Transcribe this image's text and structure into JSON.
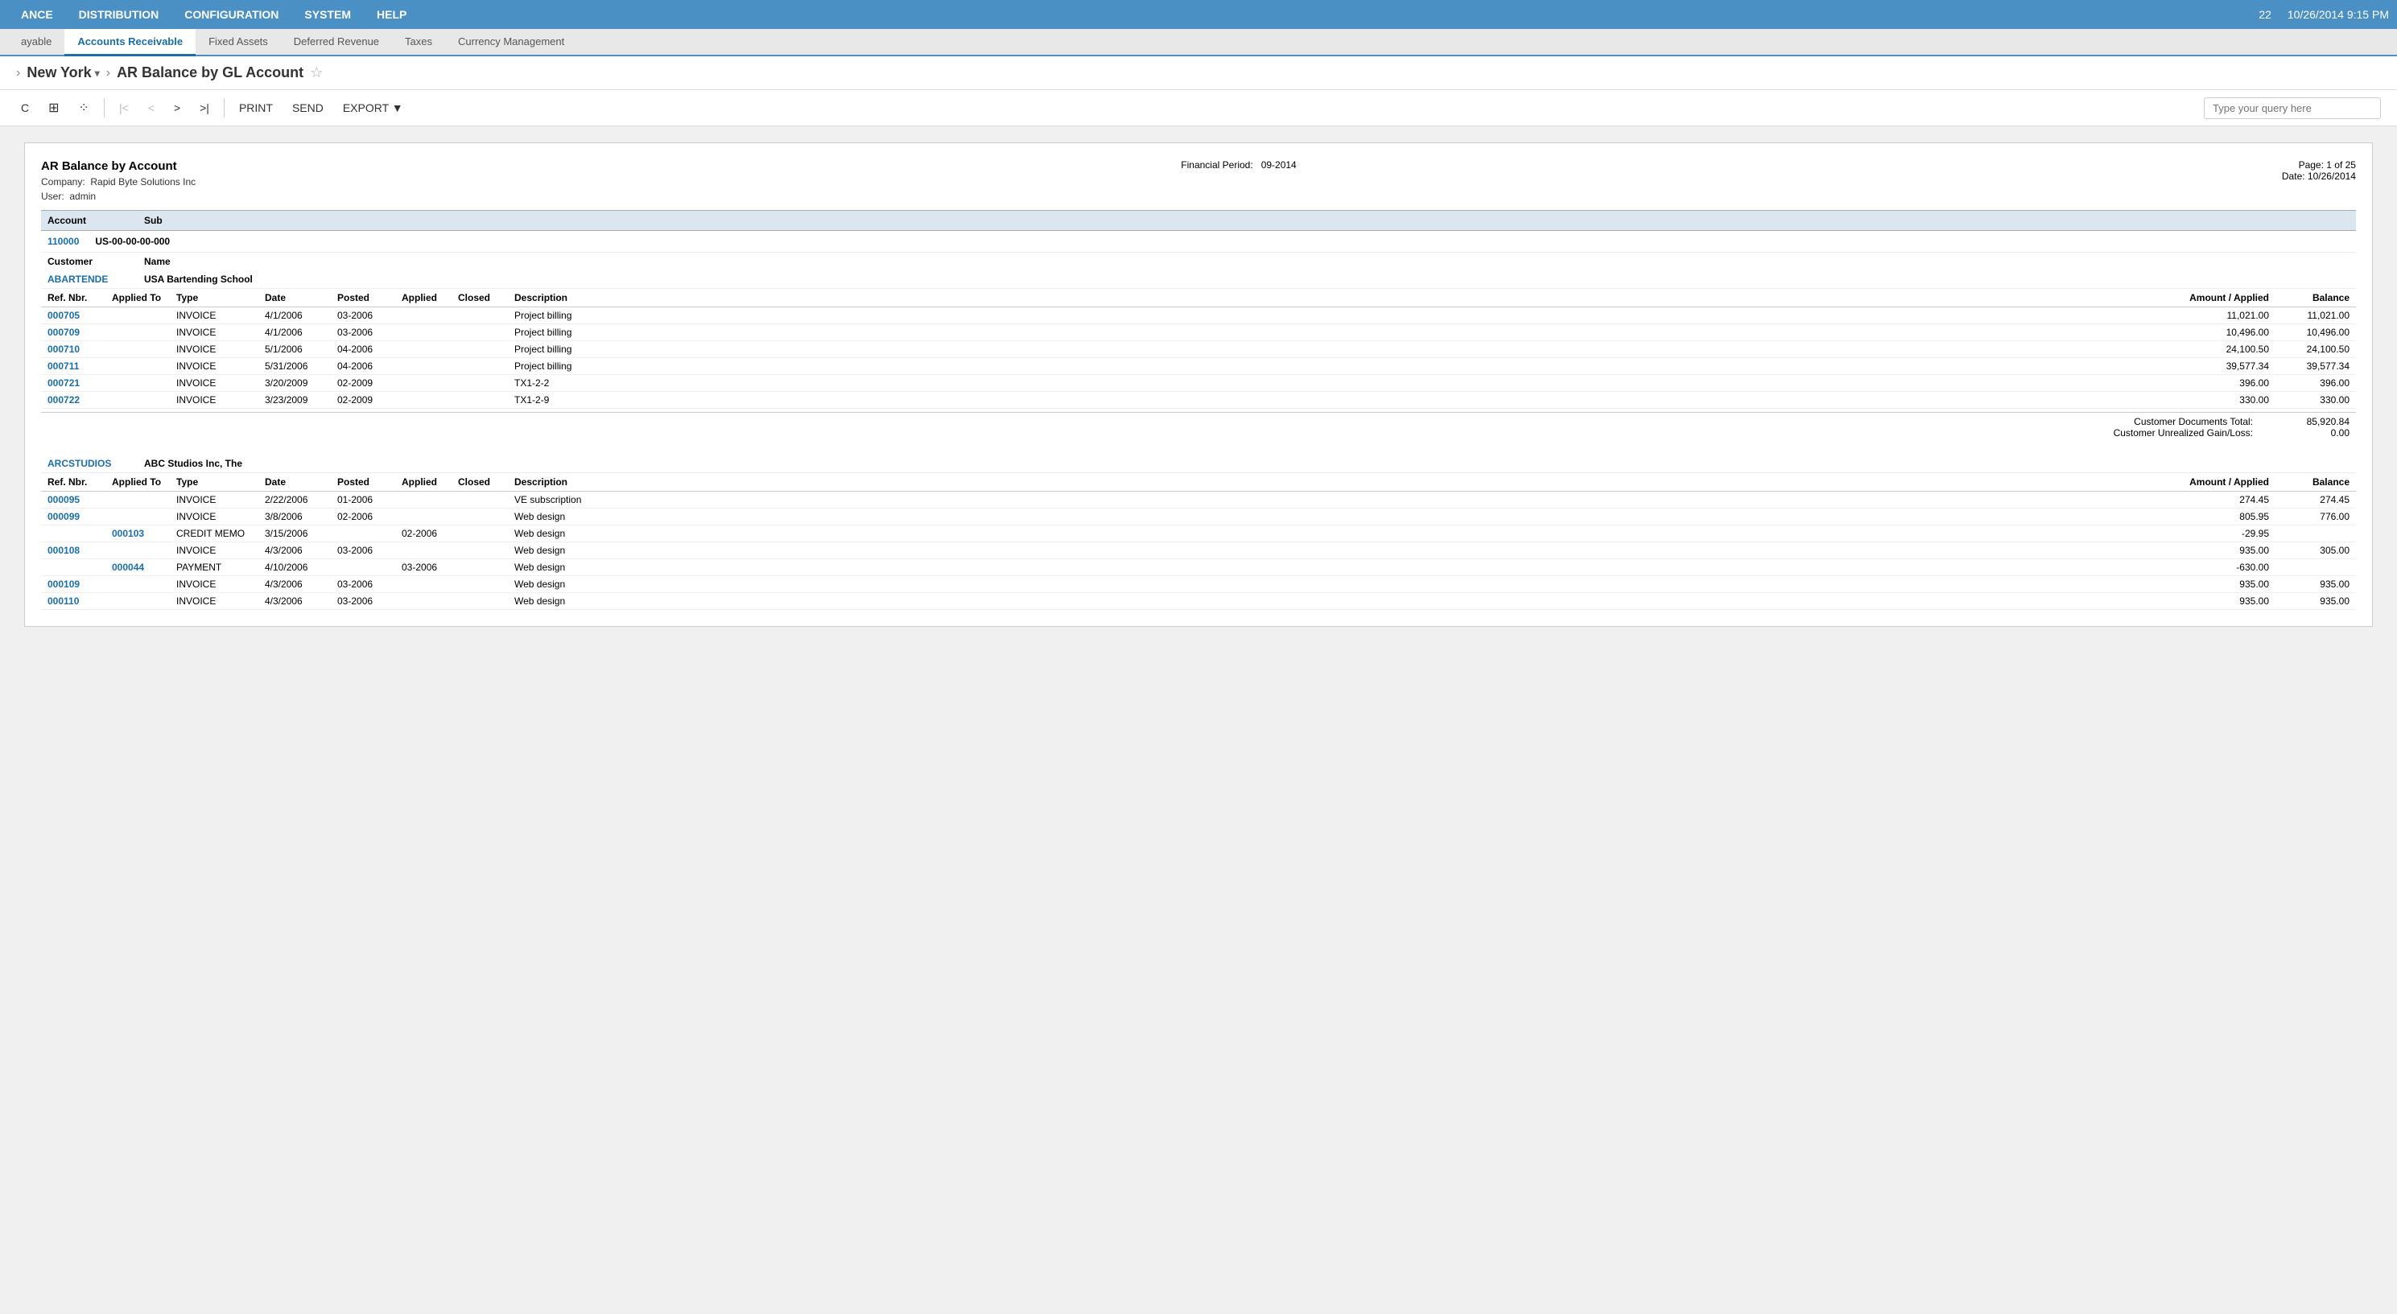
{
  "topnav": {
    "items": [
      "ANCE",
      "DISTRIBUTION",
      "CONFIGURATION",
      "SYSTEM",
      "HELP"
    ],
    "right_number": "22",
    "datetime": "10/26/2014  9:15 PM"
  },
  "tabs": [
    {
      "label": "ayable",
      "active": false
    },
    {
      "label": "Accounts Receivable",
      "active": true
    },
    {
      "label": "Fixed Assets",
      "active": false
    },
    {
      "label": "Deferred Revenue",
      "active": false
    },
    {
      "label": "Taxes",
      "active": false
    },
    {
      "label": "Currency Management",
      "active": false
    }
  ],
  "titlebar": {
    "company": "New York",
    "separator": "›",
    "pagetitle": "AR Balance by GL Account"
  },
  "toolbar": {
    "refresh": "C",
    "grid_icon": "⊞",
    "settings_icon": "⁕",
    "first": "|<",
    "prev": "<",
    "next": ">",
    "last": ">|",
    "print": "PRINT",
    "send": "SEND",
    "export": "EXPORT ▼",
    "query_placeholder": "Type your query here"
  },
  "report": {
    "title": "AR Balance by Account",
    "company_label": "Company:",
    "company_value": "Rapid Byte Solutions Inc",
    "user_label": "User:",
    "user_value": "admin",
    "financial_period_label": "Financial Period:",
    "financial_period_value": "09-2014",
    "page_label": "Page:",
    "page_value": "1 of 25",
    "date_label": "Date:",
    "date_value": "10/26/2014",
    "col_headers_main": {
      "account": "Account",
      "sub": "Sub"
    },
    "accounts": [
      {
        "account_id": "110000",
        "sub": "US-00-00-00-000",
        "customer_label": "Customer",
        "name_label": "Name",
        "customers": [
          {
            "id": "ABARTENDE",
            "name": "USA Bartending School",
            "cols": {
              "refnbr": "Ref. Nbr.",
              "appliedto": "Applied To",
              "type": "Type",
              "date": "Date",
              "posted": "Posted",
              "applied": "Applied",
              "closed": "Closed",
              "description": "Description",
              "amount": "Amount / Applied",
              "balance": "Balance"
            },
            "rows": [
              {
                "refnbr": "000705",
                "appliedto": "",
                "type": "INVOICE",
                "date": "4/1/2006",
                "posted": "03-2006",
                "applied": "",
                "closed": "",
                "description": "Project billing",
                "amount": "11,021.00",
                "balance": "11,021.00"
              },
              {
                "refnbr": "000709",
                "appliedto": "",
                "type": "INVOICE",
                "date": "4/1/2006",
                "posted": "03-2006",
                "applied": "",
                "closed": "",
                "description": "Project billing",
                "amount": "10,496.00",
                "balance": "10,496.00"
              },
              {
                "refnbr": "000710",
                "appliedto": "",
                "type": "INVOICE",
                "date": "5/1/2006",
                "posted": "04-2006",
                "applied": "",
                "closed": "",
                "description": "Project billing",
                "amount": "24,100.50",
                "balance": "24,100.50"
              },
              {
                "refnbr": "000711",
                "appliedto": "",
                "type": "INVOICE",
                "date": "5/31/2006",
                "posted": "04-2006",
                "applied": "",
                "closed": "",
                "description": "Project billing",
                "amount": "39,577.34",
                "balance": "39,577.34"
              },
              {
                "refnbr": "000721",
                "appliedto": "",
                "type": "INVOICE",
                "date": "3/20/2009",
                "posted": "02-2009",
                "applied": "",
                "closed": "",
                "description": "TX1-2-2",
                "amount": "396.00",
                "balance": "396.00"
              },
              {
                "refnbr": "000722",
                "appliedto": "",
                "type": "INVOICE",
                "date": "3/23/2009",
                "posted": "02-2009",
                "applied": "",
                "closed": "",
                "description": "TX1-2-9",
                "amount": "330.00",
                "balance": "330.00"
              }
            ],
            "totals": {
              "documents_label": "Customer Documents Total:",
              "documents_value": "85,920.84",
              "unrealized_label": "Customer Unrealized Gain/Loss:",
              "unrealized_value": "0.00"
            }
          },
          {
            "id": "ARCSTUDIOS",
            "name": "ABC Studios Inc, The",
            "cols": {
              "refnbr": "Ref. Nbr.",
              "appliedto": "Applied To",
              "type": "Type",
              "date": "Date",
              "posted": "Posted",
              "applied": "Applied",
              "closed": "Closed",
              "description": "Description",
              "amount": "Amount / Applied",
              "balance": "Balance"
            },
            "rows": [
              {
                "refnbr": "000095",
                "appliedto": "",
                "type": "INVOICE",
                "date": "2/22/2006",
                "posted": "01-2006",
                "applied": "",
                "closed": "",
                "description": "VE subscription",
                "amount": "274.45",
                "balance": "274.45"
              },
              {
                "refnbr": "000099",
                "appliedto": "",
                "type": "INVOICE",
                "date": "3/8/2006",
                "posted": "02-2006",
                "applied": "",
                "closed": "",
                "description": "Web design",
                "amount": "805.95",
                "balance": "776.00"
              },
              {
                "refnbr": "",
                "appliedto": "000103",
                "type": "CREDIT MEMO",
                "date": "3/15/2006",
                "posted": "",
                "applied": "02-2006",
                "closed": "",
                "description": "Web design",
                "amount": "-29.95",
                "balance": ""
              },
              {
                "refnbr": "000108",
                "appliedto": "",
                "type": "INVOICE",
                "date": "4/3/2006",
                "posted": "03-2006",
                "applied": "",
                "closed": "",
                "description": "Web design",
                "amount": "935.00",
                "balance": "305.00"
              },
              {
                "refnbr": "",
                "appliedto": "000044",
                "type": "PAYMENT",
                "date": "4/10/2006",
                "posted": "",
                "applied": "03-2006",
                "closed": "",
                "description": "Web design",
                "amount": "-630.00",
                "balance": ""
              },
              {
                "refnbr": "000109",
                "appliedto": "",
                "type": "INVOICE",
                "date": "4/3/2006",
                "posted": "03-2006",
                "applied": "",
                "closed": "",
                "description": "Web design",
                "amount": "935.00",
                "balance": "935.00"
              },
              {
                "refnbr": "000110",
                "appliedto": "",
                "type": "INVOICE",
                "date": "4/3/2006",
                "posted": "03-2006",
                "applied": "",
                "closed": "",
                "description": "Web design",
                "amount": "935.00",
                "balance": "935.00"
              }
            ]
          }
        ]
      }
    ]
  }
}
